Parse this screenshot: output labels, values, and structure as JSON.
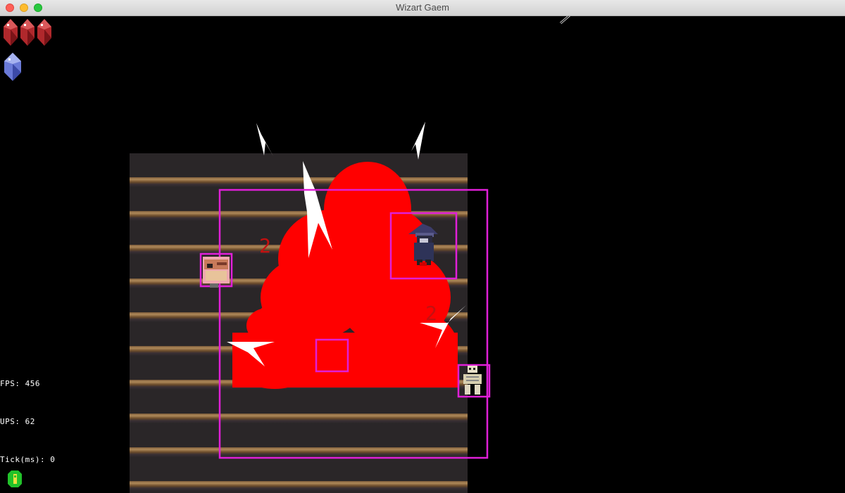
{
  "window": {
    "title": "Wizart Gaem"
  },
  "hud": {
    "health_gems": 3,
    "mana_gems": 1,
    "fps_label": "FPS: 456",
    "ups_label": "UPS: 62",
    "tick_label": "Tick(ms): 0"
  },
  "damage_numbers": [
    "2",
    "2"
  ],
  "colors": {
    "blast": "#ff0000",
    "hitbox": "#e01fd8",
    "heart_gem": "#b0282c",
    "mana_gem": "#6a7ad8",
    "coin": "#22c22a"
  },
  "icons": {
    "health": "red-crystal-heart-icon",
    "mana": "blue-crystal-mana-icon",
    "coin": "green-coin-icon"
  }
}
